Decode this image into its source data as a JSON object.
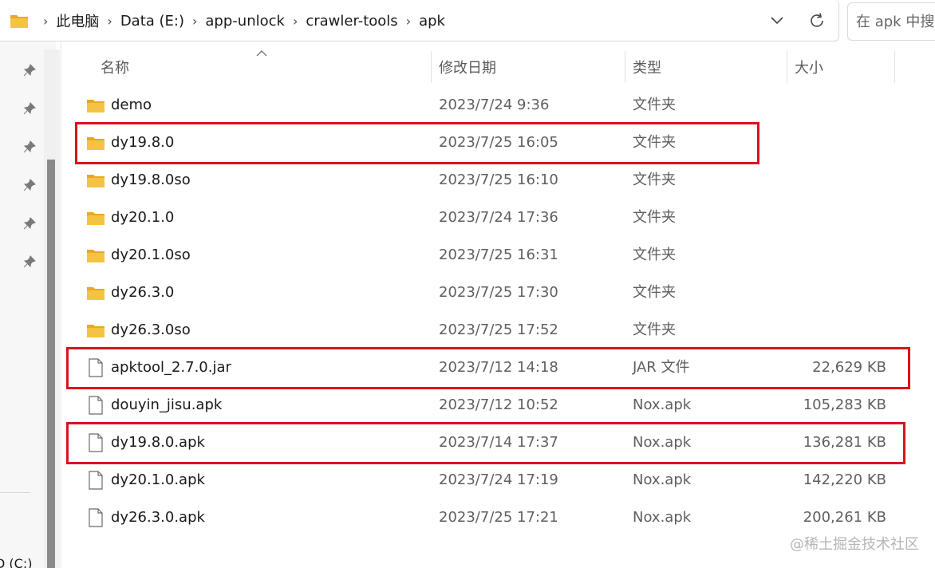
{
  "address": {
    "path": [
      "此电脑",
      "Data (E:)",
      "app-unlock",
      "crawler-tools",
      "apk"
    ],
    "separator": "›"
  },
  "search": {
    "placeholder": "在 apk 中搜索"
  },
  "columns": {
    "name": "名称",
    "modified": "修改日期",
    "type": "类型",
    "size": "大小"
  },
  "files": [
    {
      "name": "demo",
      "modified": "2023/7/24 9:36",
      "type": "文件夹",
      "size": "",
      "kind": "folder",
      "highlighted": false
    },
    {
      "name": "dy19.8.0",
      "modified": "2023/7/25 16:05",
      "type": "文件夹",
      "size": "",
      "kind": "folder",
      "highlighted": true
    },
    {
      "name": "dy19.8.0so",
      "modified": "2023/7/25 16:10",
      "type": "文件夹",
      "size": "",
      "kind": "folder",
      "highlighted": false
    },
    {
      "name": "dy20.1.0",
      "modified": "2023/7/24 17:36",
      "type": "文件夹",
      "size": "",
      "kind": "folder",
      "highlighted": false
    },
    {
      "name": "dy20.1.0so",
      "modified": "2023/7/25 16:31",
      "type": "文件夹",
      "size": "",
      "kind": "folder",
      "highlighted": false
    },
    {
      "name": "dy26.3.0",
      "modified": "2023/7/25 17:30",
      "type": "文件夹",
      "size": "",
      "kind": "folder",
      "highlighted": false
    },
    {
      "name": "dy26.3.0so",
      "modified": "2023/7/25 17:52",
      "type": "文件夹",
      "size": "",
      "kind": "folder",
      "highlighted": false
    },
    {
      "name": "apktool_2.7.0.jar",
      "modified": "2023/7/12 14:18",
      "type": "JAR 文件",
      "size": "22,629 KB",
      "kind": "file",
      "highlighted": true
    },
    {
      "name": "douyin_jisu.apk",
      "modified": "2023/7/12 10:52",
      "type": "Nox.apk",
      "size": "105,283 KB",
      "kind": "file",
      "highlighted": false
    },
    {
      "name": "dy19.8.0.apk",
      "modified": "2023/7/14 17:37",
      "type": "Nox.apk",
      "size": "136,281 KB",
      "kind": "file",
      "highlighted": true
    },
    {
      "name": "dy20.1.0.apk",
      "modified": "2023/7/24 17:19",
      "type": "Nox.apk",
      "size": "142,220 KB",
      "kind": "file",
      "highlighted": false
    },
    {
      "name": "dy26.3.0.apk",
      "modified": "2023/7/25 17:21",
      "type": "Nox.apk",
      "size": "200,261 KB",
      "kind": "file",
      "highlighted": false
    }
  ],
  "nav": {
    "drive_label": "D (C:)"
  },
  "watermark": "@稀土掘金技术社区",
  "colors": {
    "highlight": "#d9141c",
    "folder": "#f5c342",
    "folder_dark": "#e8a825"
  }
}
